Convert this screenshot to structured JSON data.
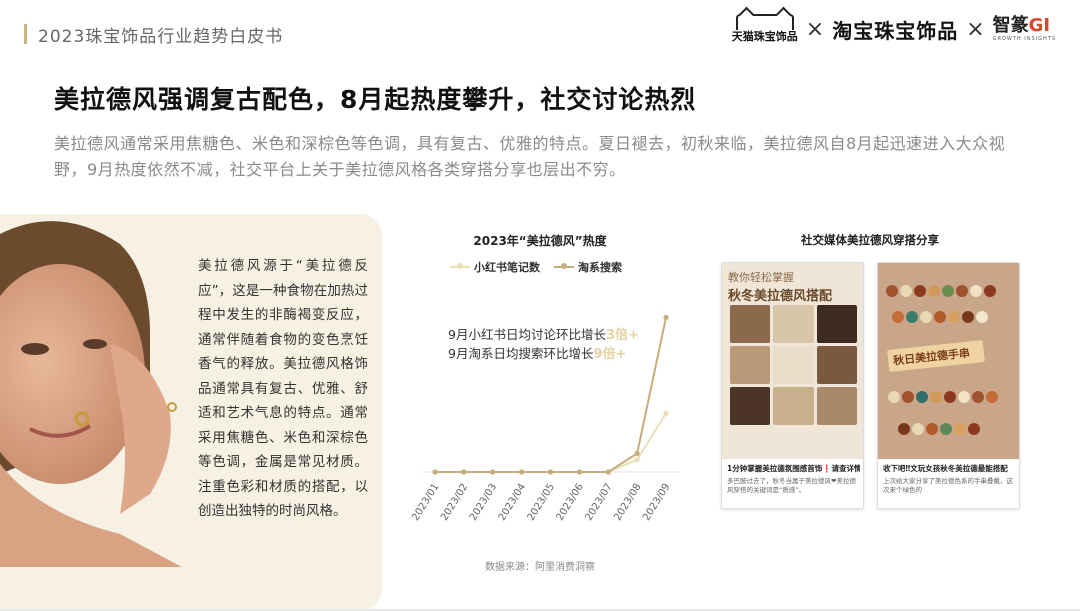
{
  "header": {
    "doc_title": "2023珠宝饰品行业趋势白皮书",
    "logo_tmall": "天猫珠宝饰品",
    "logo_separator": "×",
    "logo_taobao": "淘宝珠宝饰品",
    "logo_zz_main": "智篆",
    "logo_zz_gi": "GI",
    "logo_zz_sub": "GROWTH INSIGHTS"
  },
  "headline": "美拉德风强调复古配色，8月起热度攀升，社交讨论热烈",
  "subtext": "美拉德风通常采用焦糖色、米色和深棕色等色调，具有复古、优雅的特点。夏日褪去，初秋来临，美拉德风自8月起迅速进入大众视野，9月热度依然不减，社交平台上关于美拉德风格各类穿搭分享也层出不穷。",
  "panel_text": "美拉德风源于“美拉德反应”，这是一种食物在加热过程中发生的非酶褐变反应，通常伴随着食物的变色烹饪香气的释放。美拉德风格饰品通常具有复古、优雅、舒适和艺术气息的特点。通常采用焦糖色、米色和深棕色等色调，金属是常见材质。注重色彩和材质的搭配，以创造出独特的时尚风格。",
  "chart_data": {
    "type": "line",
    "title": "2023年“美拉德风”热度",
    "categories": [
      "2023/01",
      "2023/02",
      "2023/03",
      "2023/04",
      "2023/05",
      "2023/06",
      "2023/07",
      "2023/08",
      "2023/09"
    ],
    "series": [
      {
        "name": "小红书笔记数",
        "color": "#eadfb6",
        "values": [
          0,
          0,
          0,
          0,
          0,
          0,
          0,
          4,
          19
        ]
      },
      {
        "name": "淘系搜索",
        "color": "#c7ad7c",
        "values": [
          0,
          0,
          0,
          0,
          0,
          0,
          0,
          6,
          50
        ]
      }
    ],
    "annotations": [
      {
        "prefix": "9月小红书日均讨论环比增长",
        "highlight": "3倍+"
      },
      {
        "prefix": "9月淘系日均搜索环比增长",
        "highlight": "9倍+"
      }
    ],
    "source": "数据来源：阿里消费洞察",
    "ylim": [
      0,
      55
    ]
  },
  "social": {
    "title": "社交媒体美拉德风穿搭分享",
    "card1": {
      "caption_top": "教你轻松掌握",
      "caption_main": "秋冬美拉德风搭配",
      "line1": "1分钟掌握美拉德氛围感首饰❗请查详情",
      "line2": "多巴胺过去了，秋冬当属于美拉德风❤美拉德风穿搭的关键词是“质感”。"
    },
    "card2": {
      "banner": "秋日美拉德手串",
      "line1": "收下吧‼文玩女孩秋冬美拉德最能搭配",
      "line2": "上次给大家分享了美拉德色系的手串叠戴，这次来个绿色的"
    }
  },
  "colors": {
    "accent": "#c9b37e",
    "panel_bg": "#f7f1e3",
    "xhs_line": "#eadfb6",
    "taobao_line": "#c7ad7c"
  }
}
